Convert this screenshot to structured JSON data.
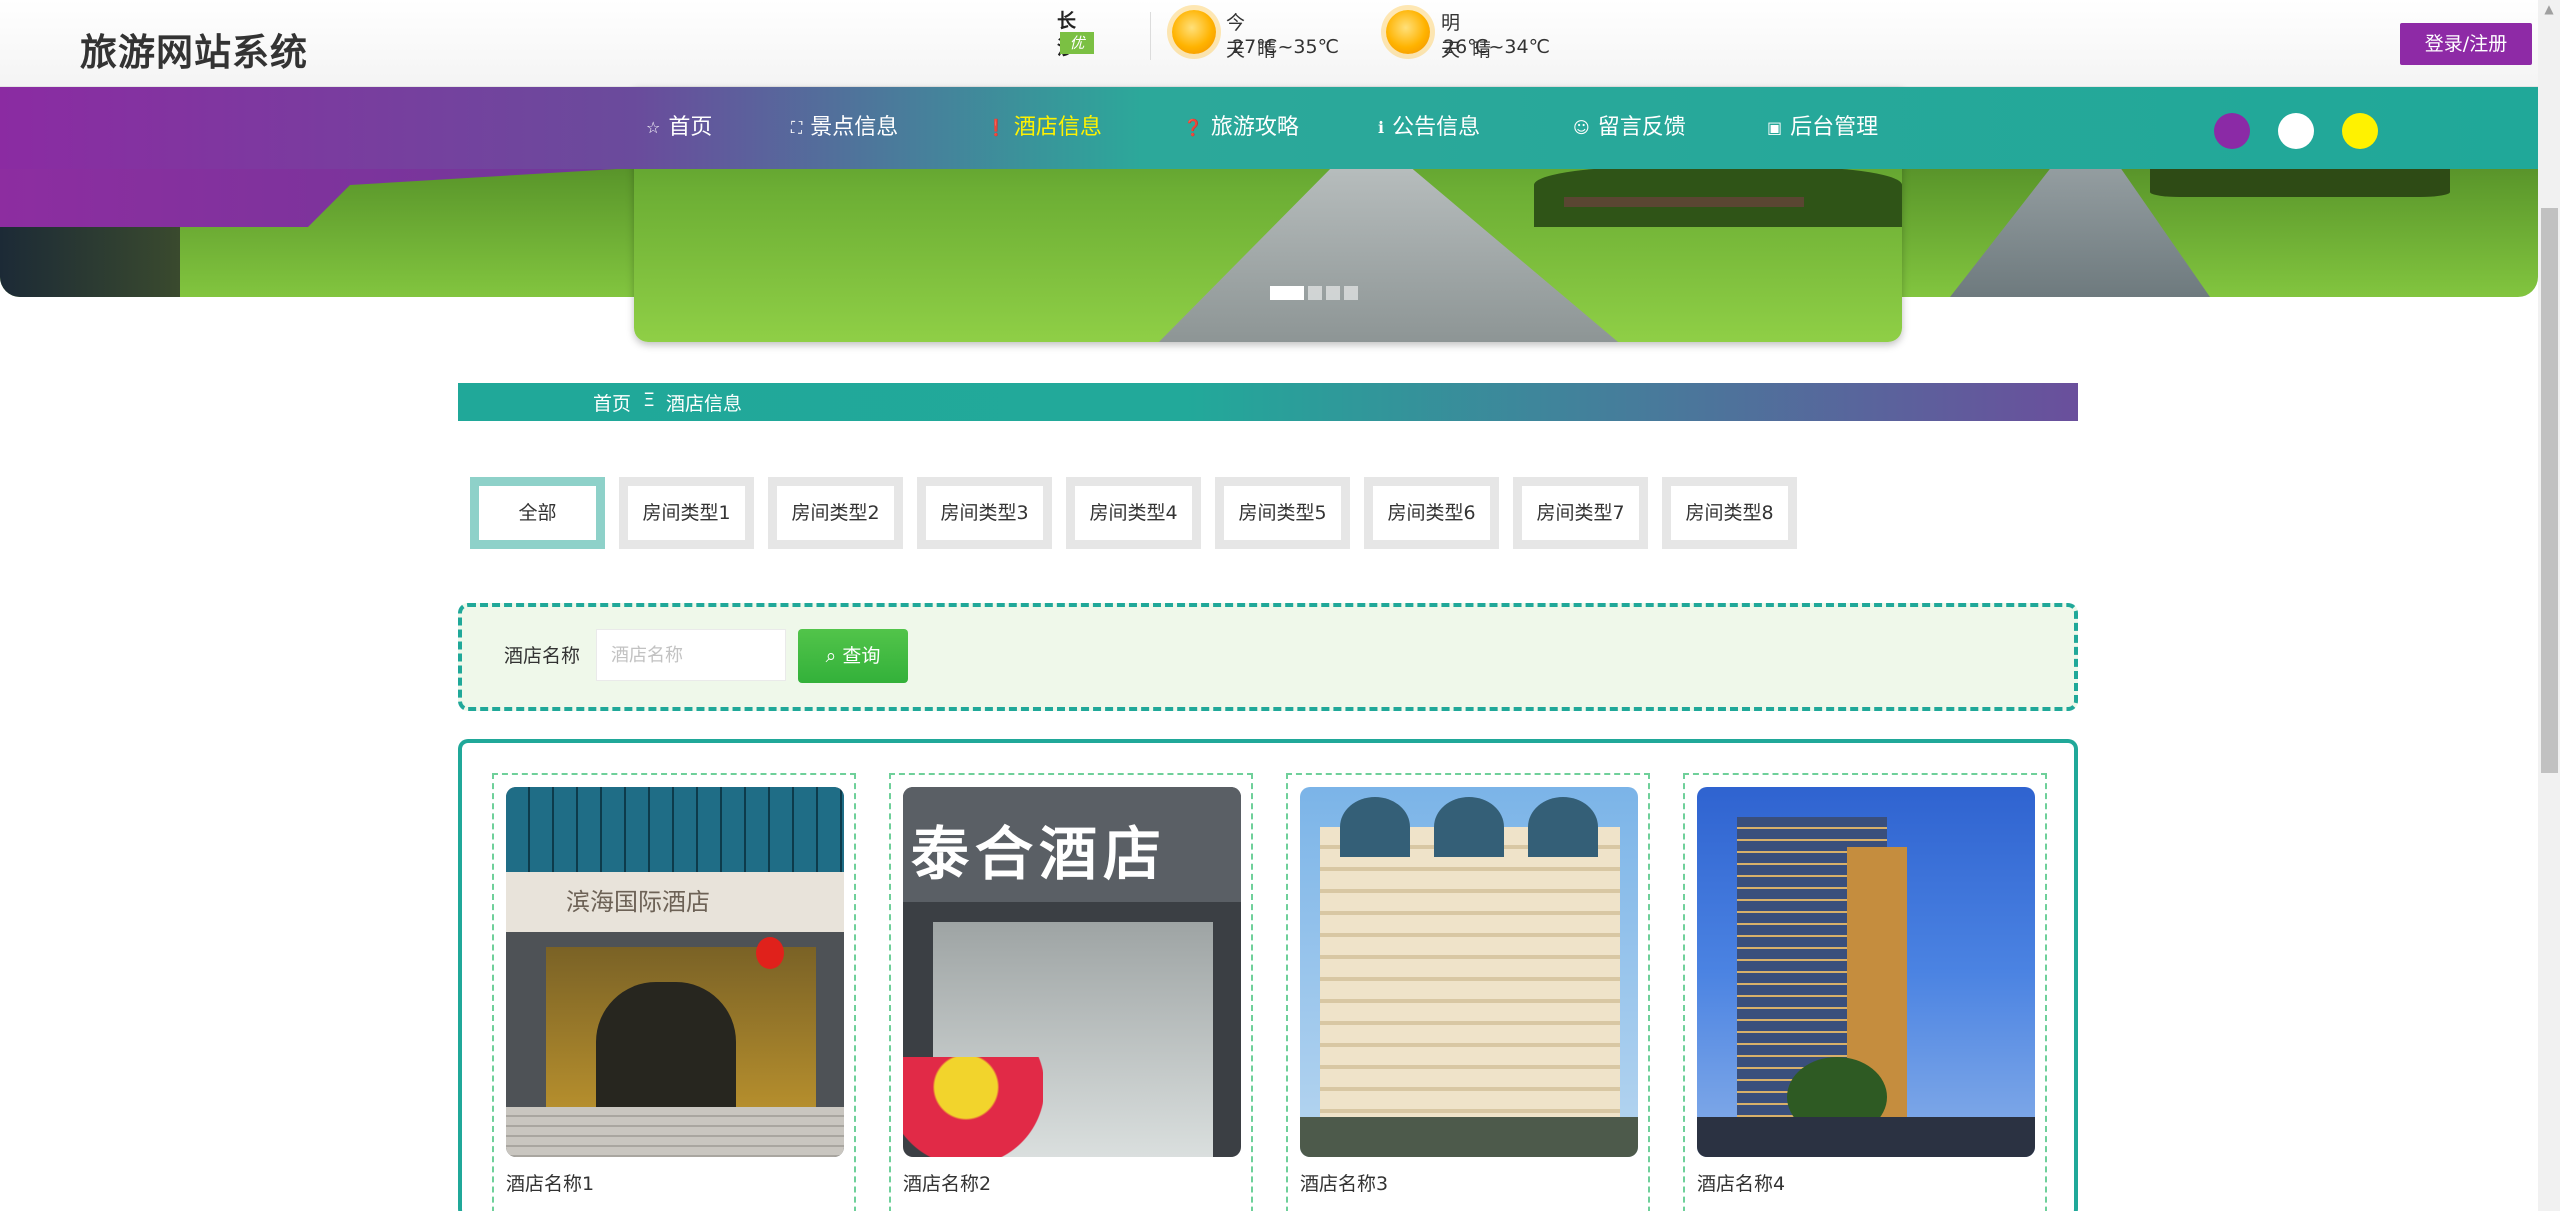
{
  "header": {
    "site_title": "旅游网站系统",
    "login_label": "登录/注册"
  },
  "weather": {
    "city": "长沙",
    "air_quality": "优",
    "today_label": "今天",
    "today_condition": "晴",
    "today_temp": "27℃~35℃",
    "tomorrow_label": "明天",
    "tomorrow_condition": "晴",
    "tomorrow_temp": "26℃~34℃",
    "icon": "sun-icon"
  },
  "nav": {
    "items": [
      {
        "label": "首页",
        "icon": "☆"
      },
      {
        "label": "景点信息",
        "icon": "⛶"
      },
      {
        "label": "酒店信息",
        "icon": "❗"
      },
      {
        "label": "旅游攻略",
        "icon": "❓"
      },
      {
        "label": "公告信息",
        "icon": "ℹ"
      },
      {
        "label": "留言反馈",
        "icon": "☺"
      },
      {
        "label": "后台管理",
        "icon": "▣"
      }
    ],
    "active_index": 2,
    "theme_colors": [
      "#8b2aa6",
      "#ffffff",
      "#fff200"
    ]
  },
  "breadcrumb": {
    "home": "首页",
    "separator": "Ξ",
    "current": "酒店信息"
  },
  "tabs": [
    "全部",
    "房间类型1",
    "房间类型2",
    "房间类型3",
    "房间类型4",
    "房间类型5",
    "房间类型6",
    "房间类型7",
    "房间类型8"
  ],
  "search": {
    "label": "酒店名称",
    "placeholder": "酒店名称",
    "button_label": "查询"
  },
  "hotels": [
    {
      "name": "酒店名称1",
      "photo_sign": "滨海国际酒店"
    },
    {
      "name": "酒店名称2",
      "photo_sign": "泰合酒店"
    },
    {
      "name": "酒店名称3"
    },
    {
      "name": "酒店名称4"
    }
  ],
  "colors": {
    "accent": "#20a899",
    "purple": "#8b2aa6",
    "highlight": "#fff200",
    "search_button": "#3bb53f"
  }
}
